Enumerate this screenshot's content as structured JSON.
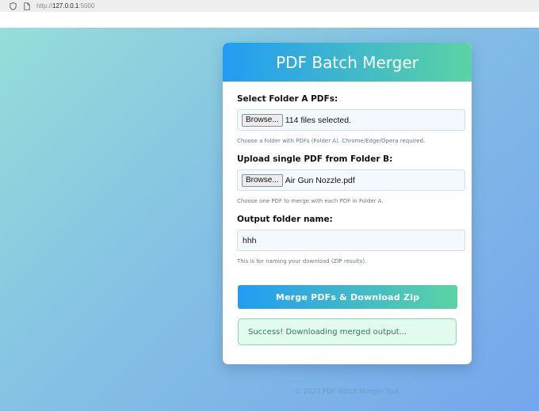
{
  "browser": {
    "url_prefix": "http://",
    "url_host": "127.0.0.1",
    "url_port": ":5000",
    "icons": [
      "shield-icon",
      "page-icon"
    ]
  },
  "app": {
    "title": "PDF Batch Merger"
  },
  "form": {
    "folder_a": {
      "label": "Select Folder A PDFs:",
      "button": "Browse...",
      "status": "114 files selected.",
      "hint": "Choose a folder with PDFs (Folder A). Chrome/Edge/Opera required."
    },
    "folder_b": {
      "label": "Upload single PDF from Folder B:",
      "button": "Browse...",
      "status": "Air Gun Nozzle.pdf",
      "hint": "Choose one PDF to merge with each PDF in Folder A."
    },
    "output": {
      "label": "Output folder name:",
      "value": "hhh",
      "hint": "This is for naming your download (ZIP results)."
    },
    "submit_label": "Merge PDFs & Download Zip"
  },
  "status": {
    "message": "Success! Downloading merged output..."
  },
  "footer": {
    "text": "© 2025 PDF Batch Merger Tool"
  },
  "colors": {
    "accent_start": "#229cf3",
    "accent_end": "#5bd3a4",
    "success_bg": "#e3fbef",
    "success_text": "#2e7d5a"
  }
}
